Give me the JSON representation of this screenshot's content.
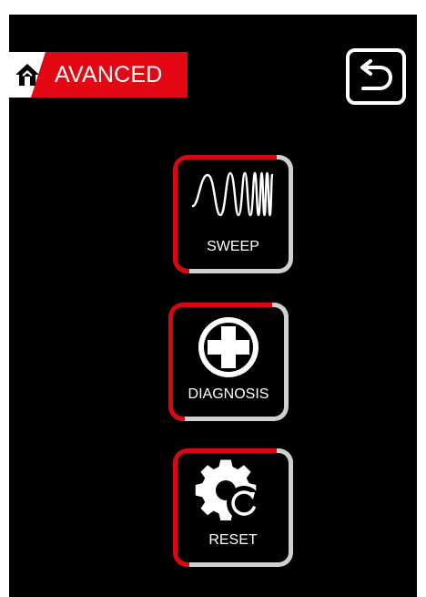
{
  "header": {
    "title": "AVANCED",
    "home_icon": "home-icon",
    "accent_color": "#e30613"
  },
  "toolbar": {
    "back_icon": "undo-arrow-icon"
  },
  "menu": {
    "items": [
      {
        "label": "SWEEP",
        "icon": "sine-sweep-icon"
      },
      {
        "label": "DIAGNOSIS",
        "icon": "medical-cross-icon"
      },
      {
        "label": "RESET",
        "icon": "gear-reset-icon"
      }
    ]
  },
  "colors": {
    "background": "#000000",
    "tile_red": "#d80813",
    "tile_gray": "#d0d0d0",
    "text": "#ffffff"
  }
}
